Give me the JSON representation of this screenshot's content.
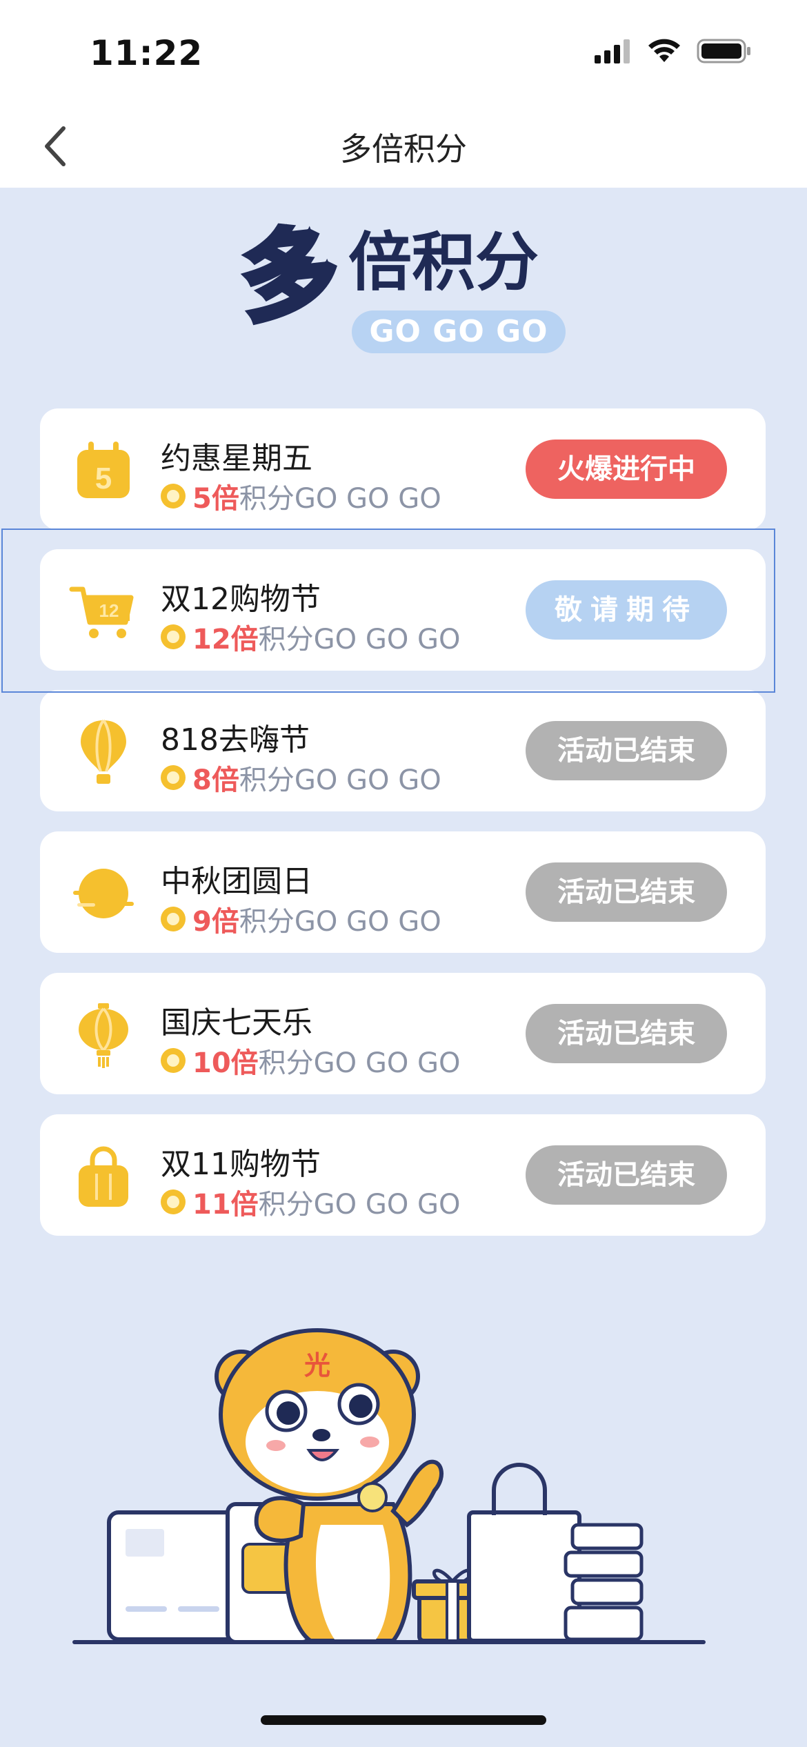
{
  "status_bar": {
    "time": "11:22"
  },
  "nav": {
    "title": "多倍积分"
  },
  "hero": {
    "title_main": "多",
    "title_rest": "倍积分",
    "tagline": "GO GO GO"
  },
  "activities": [
    {
      "name": "约惠星期五",
      "multiplier": "5倍",
      "suffix": "积分GO GO GO",
      "status": "火爆进行中",
      "state": "active",
      "icon": "calendar-icon"
    },
    {
      "name": "双12购物节",
      "multiplier": "12倍",
      "suffix": "积分GO GO GO",
      "status": "敬请期待",
      "state": "soon",
      "icon": "shopping-cart-icon"
    },
    {
      "name": "818去嗨节",
      "multiplier": "8倍",
      "suffix": "积分GO GO GO",
      "status": "活动已结束",
      "state": "ended",
      "icon": "hot-air-balloon-icon"
    },
    {
      "name": "中秋团圆日",
      "multiplier": "9倍",
      "suffix": "积分GO GO GO",
      "status": "活动已结束",
      "state": "ended",
      "icon": "moon-icon"
    },
    {
      "name": "国庆七天乐",
      "multiplier": "10倍",
      "suffix": "积分GO GO GO",
      "status": "活动已结束",
      "state": "ended",
      "icon": "lantern-icon"
    },
    {
      "name": "双11购物节",
      "multiplier": "11倍",
      "suffix": "积分GO GO GO",
      "status": "活动已结束",
      "state": "ended",
      "icon": "shopping-bag-icon"
    }
  ],
  "mascot": {
    "badge_char": "光"
  },
  "colors": {
    "accent_red": "#ee5a5a",
    "active_pill": "#ee6360",
    "soon_pill": "#b6d2f2",
    "ended_pill": "#b2b2b2",
    "icon_yellow": "#f5c02e",
    "page_bg": "#dfe7f6"
  }
}
